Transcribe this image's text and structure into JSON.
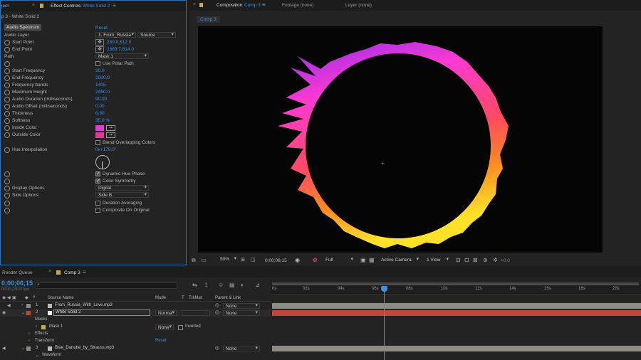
{
  "colors": {
    "accent": "#3d8fe0",
    "bar_red": "#c0483a",
    "bar_gray": "#8c8c84",
    "panel_bg": "#232323"
  },
  "effect_panel": {
    "project_tab": "ject",
    "tab_title": "Effect Controls",
    "tab_layer": "White Solid 2",
    "breadcrumb": "p 3 - White Solid 2",
    "effect_name": "Audio Spectrum",
    "reset": "Reset",
    "rows": [
      {
        "label": "Audio Layer",
        "value": "1. From_Russia",
        "extra": "Source"
      },
      {
        "label": "Start Point",
        "value": "280.0,612.0"
      },
      {
        "label": "End Point",
        "value": "1669.7,614.0"
      },
      {
        "label": "Path",
        "value": "Mask 1"
      },
      {
        "label": "",
        "value": "Use Polar Path"
      },
      {
        "label": "Start Frequency",
        "value": "20.0"
      },
      {
        "label": "End Frequency",
        "value": "2000.0"
      },
      {
        "label": "Frequency bands",
        "value": "1405"
      },
      {
        "label": "Maximum Height",
        "value": "2450.0"
      },
      {
        "label": "Audio Duration (milliseconds)",
        "value": "90.00"
      },
      {
        "label": "Audio Offset (milliseconds)",
        "value": "0.00"
      },
      {
        "label": "Thickness",
        "value": "6.90"
      },
      {
        "label": "Softness",
        "value": "35.0 %"
      },
      {
        "label": "Inside Color",
        "value": ""
      },
      {
        "label": "Outside Color",
        "value": ""
      },
      {
        "label": "",
        "value": "Blend Overlapping Colors"
      },
      {
        "label": "Hue Interpolation",
        "value": "0x+179.0°"
      },
      {
        "label": "",
        "value": "Dynamic Hue Phase"
      },
      {
        "label": "",
        "value": "Color Symmetry"
      },
      {
        "label": "Display Options",
        "value": "Digital"
      },
      {
        "label": "Side Options",
        "value": "Side B"
      },
      {
        "label": "",
        "value": "Duration Averaging"
      },
      {
        "label": "",
        "value": "Composite On Original"
      }
    ]
  },
  "comp_panel": {
    "tab_prefix": "Composition",
    "tab_name": "Comp 3",
    "footage": "Footage (none)",
    "layer": "Layer (none)",
    "sub_tab": "Comp 3",
    "toolbar": {
      "zoom": "50%",
      "time": "0;00;06;15",
      "resolution": "Full",
      "camera": "Active Camera",
      "view": "1 View",
      "exposure": "+0.0"
    }
  },
  "timeline": {
    "render_queue": "Render Queue",
    "comp_tab": "Comp 3",
    "timecode": "0;00;06;15",
    "fps": "00195 (29.97 fps)",
    "search_placeholder": "",
    "headers": {
      "source": "Source Name",
      "mode": "Mode",
      "t": "T",
      "trkmat": "TrkMat",
      "parent": "Parent & Link"
    },
    "ruler": [
      "0s",
      "02s",
      "04s",
      "06s",
      "08s",
      "10s",
      "12s",
      "14s",
      "16s",
      "18s",
      "20s"
    ],
    "layers": [
      {
        "num": "1",
        "name": "From_Russia_With_Love.mp3",
        "parent": "None"
      },
      {
        "num": "2",
        "name": "White Solid 2",
        "mode": "Norma",
        "parent": "None"
      },
      {
        "num": "",
        "name": "Masks"
      },
      {
        "num": "",
        "name": "Mask 1",
        "mode": "None",
        "extra": "Inverted"
      },
      {
        "num": "",
        "name": "Effects"
      },
      {
        "num": "",
        "name": "Transform",
        "extra": "Reset"
      },
      {
        "num": "3",
        "name": "Blue_Danube_by_Strauss.mp3",
        "parent": "None"
      },
      {
        "num": "",
        "name": "Waveform"
      }
    ]
  }
}
